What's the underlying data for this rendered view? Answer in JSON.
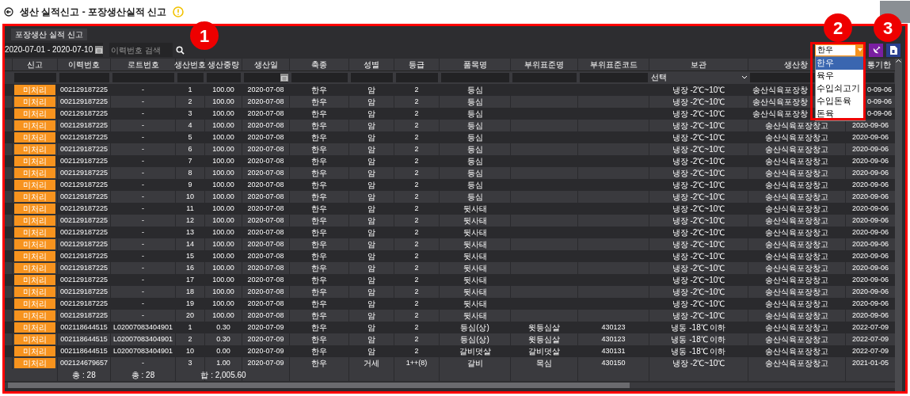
{
  "window": {
    "title": "생산 실적신고 - 포장생산실적 신고"
  },
  "tabs": [
    {
      "label": "포장생산 실적 신고",
      "selected": true
    }
  ],
  "toolbar": {
    "date_range": "2020-07-01 - 2020-07-10",
    "search": {
      "placeholder": "이력번호 검색"
    },
    "species_select": {
      "value": "한우",
      "expanded": true,
      "options": [
        {
          "label": "한우",
          "selected": true
        },
        {
          "label": "육우",
          "selected": false
        },
        {
          "label": "수입쇠고기",
          "selected": false
        },
        {
          "label": "수입돈육",
          "selected": false
        },
        {
          "label": "돈육",
          "selected": false
        }
      ]
    }
  },
  "callouts": [
    "1",
    "2",
    "3"
  ],
  "table": {
    "columns": [
      {
        "label": "신고"
      },
      {
        "label": "이력번호"
      },
      {
        "label": "로트번호"
      },
      {
        "label": "생산번호"
      },
      {
        "label": "생산중량"
      },
      {
        "label": "생산일"
      },
      {
        "label": "축종"
      },
      {
        "label": "성별"
      },
      {
        "label": "등급"
      },
      {
        "label": "품목명"
      },
      {
        "label": "부위표준명"
      },
      {
        "label": "부위표준코드"
      },
      {
        "label": "보관"
      },
      {
        "label": "생산창"
      },
      {
        "label": "통기한"
      }
    ],
    "storage_filter": "선택",
    "rows": [
      {
        "status": "미처리",
        "trace": "002129187225",
        "lot": "-",
        "no": "1",
        "weight": "100.00",
        "date": "2020-07-08",
        "species": "한우",
        "sex": "암",
        "grade": "2",
        "item": "등심",
        "storage": "냉장 -2℃~10℃",
        "warehouse": "송산식육포장창",
        "expiry": "0-09-06"
      },
      {
        "status": "미처리",
        "trace": "002129187225",
        "lot": "-",
        "no": "2",
        "weight": "100.00",
        "date": "2020-07-08",
        "species": "한우",
        "sex": "암",
        "grade": "2",
        "item": "등심",
        "storage": "냉장 -2℃~10℃",
        "warehouse": "송산식육포장창",
        "expiry": "0-09-06"
      },
      {
        "status": "미처리",
        "trace": "002129187225",
        "lot": "-",
        "no": "3",
        "weight": "100.00",
        "date": "2020-07-08",
        "species": "한우",
        "sex": "암",
        "grade": "2",
        "item": "등심",
        "storage": "냉장 -2℃~10℃",
        "warehouse": "송산식육포장창",
        "expiry": "0-09-06"
      },
      {
        "status": "미처리",
        "trace": "002129187225",
        "lot": "-",
        "no": "4",
        "weight": "100.00",
        "date": "2020-07-08",
        "species": "한우",
        "sex": "암",
        "grade": "2",
        "item": "등심",
        "storage": "냉장 -2℃~10℃",
        "warehouse": "송산식육포장창고",
        "expiry": "2020-09-06"
      },
      {
        "status": "미처리",
        "trace": "002129187225",
        "lot": "-",
        "no": "5",
        "weight": "100.00",
        "date": "2020-07-08",
        "species": "한우",
        "sex": "암",
        "grade": "2",
        "item": "등심",
        "storage": "냉장 -2℃~10℃",
        "warehouse": "송산식육포장창고",
        "expiry": "2020-09-06"
      },
      {
        "status": "미처리",
        "trace": "002129187225",
        "lot": "-",
        "no": "6",
        "weight": "100.00",
        "date": "2020-07-08",
        "species": "한우",
        "sex": "암",
        "grade": "2",
        "item": "등심",
        "storage": "냉장 -2℃~10℃",
        "warehouse": "송산식육포장창고",
        "expiry": "2020-09-06"
      },
      {
        "status": "미처리",
        "trace": "002129187225",
        "lot": "-",
        "no": "7",
        "weight": "100.00",
        "date": "2020-07-08",
        "species": "한우",
        "sex": "암",
        "grade": "2",
        "item": "등심",
        "storage": "냉장 -2℃~10℃",
        "warehouse": "송산식육포장창고",
        "expiry": "2020-09-06"
      },
      {
        "status": "미처리",
        "trace": "002129187225",
        "lot": "-",
        "no": "8",
        "weight": "100.00",
        "date": "2020-07-08",
        "species": "한우",
        "sex": "암",
        "grade": "2",
        "item": "등심",
        "storage": "냉장 -2℃~10℃",
        "warehouse": "송산식육포장창고",
        "expiry": "2020-09-06"
      },
      {
        "status": "미처리",
        "trace": "002129187225",
        "lot": "-",
        "no": "9",
        "weight": "100.00",
        "date": "2020-07-08",
        "species": "한우",
        "sex": "암",
        "grade": "2",
        "item": "등심",
        "storage": "냉장 -2℃~10℃",
        "warehouse": "송산식육포장창고",
        "expiry": "2020-09-06"
      },
      {
        "status": "미처리",
        "trace": "002129187225",
        "lot": "-",
        "no": "10",
        "weight": "100.00",
        "date": "2020-07-08",
        "species": "한우",
        "sex": "암",
        "grade": "2",
        "item": "등심",
        "storage": "냉장 -2℃~10℃",
        "warehouse": "송산식육포장창고",
        "expiry": "2020-09-06"
      },
      {
        "status": "미처리",
        "trace": "002129187225",
        "lot": "-",
        "no": "11",
        "weight": "100.00",
        "date": "2020-07-08",
        "species": "한우",
        "sex": "암",
        "grade": "2",
        "item": "뒷사태",
        "storage": "냉장 -2℃~10℃",
        "warehouse": "송산식육포장창고",
        "expiry": "2020-09-06"
      },
      {
        "status": "미처리",
        "trace": "002129187225",
        "lot": "-",
        "no": "12",
        "weight": "100.00",
        "date": "2020-07-08",
        "species": "한우",
        "sex": "암",
        "grade": "2",
        "item": "뒷사태",
        "storage": "냉장 -2℃~10℃",
        "warehouse": "송산식육포장창고",
        "expiry": "2020-09-06"
      },
      {
        "status": "미처리",
        "trace": "002129187225",
        "lot": "-",
        "no": "13",
        "weight": "100.00",
        "date": "2020-07-08",
        "species": "한우",
        "sex": "암",
        "grade": "2",
        "item": "뒷사태",
        "storage": "냉장 -2℃~10℃",
        "warehouse": "송산식육포장창고",
        "expiry": "2020-09-06"
      },
      {
        "status": "미처리",
        "trace": "002129187225",
        "lot": "-",
        "no": "14",
        "weight": "100.00",
        "date": "2020-07-08",
        "species": "한우",
        "sex": "암",
        "grade": "2",
        "item": "뒷사태",
        "storage": "냉장 -2℃~10℃",
        "warehouse": "송산식육포장창고",
        "expiry": "2020-09-06"
      },
      {
        "status": "미처리",
        "trace": "002129187225",
        "lot": "-",
        "no": "15",
        "weight": "100.00",
        "date": "2020-07-08",
        "species": "한우",
        "sex": "암",
        "grade": "2",
        "item": "뒷사태",
        "storage": "냉장 -2℃~10℃",
        "warehouse": "송산식육포장창고",
        "expiry": "2020-09-06"
      },
      {
        "status": "미처리",
        "trace": "002129187225",
        "lot": "-",
        "no": "16",
        "weight": "100.00",
        "date": "2020-07-08",
        "species": "한우",
        "sex": "암",
        "grade": "2",
        "item": "뒷사태",
        "storage": "냉장 -2℃~10℃",
        "warehouse": "송산식육포장창고",
        "expiry": "2020-09-06"
      },
      {
        "status": "미처리",
        "trace": "002129187225",
        "lot": "-",
        "no": "17",
        "weight": "100.00",
        "date": "2020-07-08",
        "species": "한우",
        "sex": "암",
        "grade": "2",
        "item": "뒷사태",
        "storage": "냉장 -2℃~10℃",
        "warehouse": "송산식육포장창고",
        "expiry": "2020-09-06"
      },
      {
        "status": "미처리",
        "trace": "002129187225",
        "lot": "-",
        "no": "18",
        "weight": "100.00",
        "date": "2020-07-08",
        "species": "한우",
        "sex": "암",
        "grade": "2",
        "item": "뒷사태",
        "storage": "냉장 -2℃~10℃",
        "warehouse": "송산식육포장창고",
        "expiry": "2020-09-06"
      },
      {
        "status": "미처리",
        "trace": "002129187225",
        "lot": "-",
        "no": "19",
        "weight": "100.00",
        "date": "2020-07-08",
        "species": "한우",
        "sex": "암",
        "grade": "2",
        "item": "뒷사태",
        "storage": "냉장 -2℃~10℃",
        "warehouse": "송산식육포장창고",
        "expiry": "2020-09-06"
      },
      {
        "status": "미처리",
        "trace": "002129187225",
        "lot": "-",
        "no": "20",
        "weight": "100.00",
        "date": "2020-07-08",
        "species": "한우",
        "sex": "암",
        "grade": "2",
        "item": "뒷사태",
        "storage": "냉장 -2℃~10℃",
        "warehouse": "송산식육포장창고",
        "expiry": "2020-09-06"
      },
      {
        "status": "미처리",
        "trace": "002118644515",
        "lot": "L02007083404901",
        "no": "1",
        "weight": "0.30",
        "date": "2020-07-09",
        "species": "한우",
        "sex": "암",
        "grade": "2",
        "item": "등심(상)",
        "part_name": "윗등심살",
        "part_code": "430123",
        "storage": "냉동 -18℃ 이하",
        "warehouse": "송산식육포장창고",
        "expiry": "2022-07-09"
      },
      {
        "status": "미처리",
        "trace": "002118644515",
        "lot": "L02007083404901",
        "no": "2",
        "weight": "0.30",
        "date": "2020-07-09",
        "species": "한우",
        "sex": "암",
        "grade": "2",
        "item": "등심(상)",
        "part_name": "윗등심살",
        "part_code": "430123",
        "storage": "냉동 -18℃ 이하",
        "warehouse": "송산식육포장창고",
        "expiry": "2022-07-09"
      },
      {
        "status": "미처리",
        "trace": "002118644515",
        "lot": "L02007083404901",
        "no": "10",
        "weight": "0.00",
        "date": "2020-07-09",
        "species": "한우",
        "sex": "암",
        "grade": "2",
        "item": "갈비덧살",
        "part_name": "갈비덧살",
        "part_code": "430131",
        "storage": "냉동 -18℃ 이하",
        "warehouse": "송산식육포장창고",
        "expiry": "2022-07-09"
      },
      {
        "status": "미처리",
        "trace": "002124679657",
        "lot": "-",
        "no": "3",
        "weight": "1.00",
        "date": "2020-07-09",
        "species": "한우",
        "sex": "거세",
        "grade": "1++(8)",
        "item": "갈비",
        "part_name": "목심",
        "part_code": "430150",
        "storage": "냉장 -2℃~10℃",
        "warehouse": "송산식육포장창고",
        "expiry": "2021-01-05"
      }
    ],
    "footer": {
      "trace": "총 : 28",
      "lot": "총 : 28",
      "weight": "합 : 2,005.60"
    }
  }
}
